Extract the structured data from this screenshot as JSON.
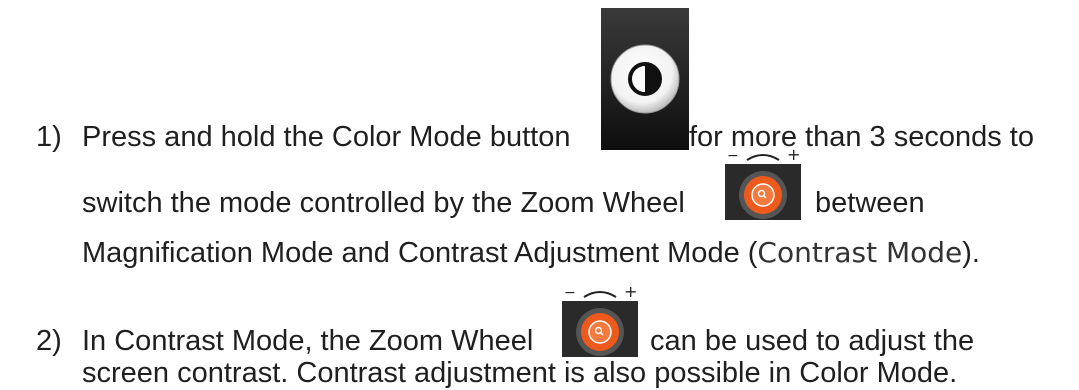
{
  "items": [
    {
      "number": "1)",
      "line1_before": "Press and hold the Color Mode button",
      "line1_after": "for more than 3 seconds to",
      "line2_before": "switch the mode controlled by the Zoom Wheel",
      "line2_after": "between",
      "line3_before": "Magnification Mode and Contrast Adjustment Mode (",
      "line3_paren": "Contrast Mode",
      "line3_after": ")."
    },
    {
      "number": "2)",
      "line1_before": "In Contrast Mode, the Zoom Wheel",
      "line1_after": "can be used to adjust the",
      "line2": "screen contrast. Contrast adjustment is also possible in Color Mode."
    }
  ],
  "icons": {
    "color_mode": "contrast-circle-icon",
    "zoom_wheel": "zoom-wheel-icon",
    "wheel_minus": "−",
    "wheel_plus": "+"
  }
}
